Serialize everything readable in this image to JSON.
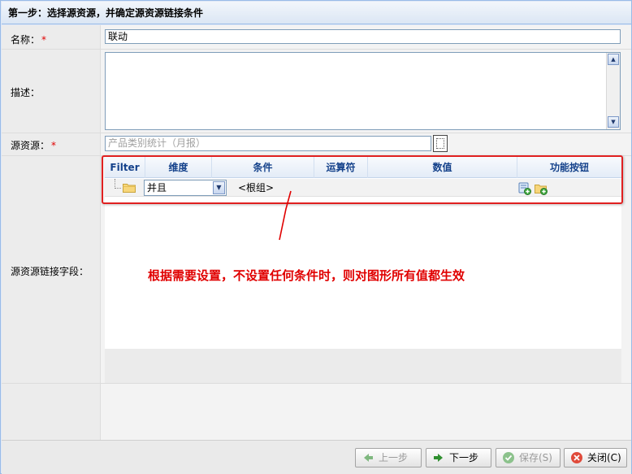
{
  "title": {
    "text": "第一步：选择源资源，并确定源资源链接条件"
  },
  "form": {
    "name_label": "名称：",
    "name_required": "*",
    "name_value": "联动",
    "desc_label": "描述：",
    "source_label": "源资源：",
    "source_required": "*",
    "source_placeholder": "产品类别统计（月报）",
    "link_label": "源资源链接字段："
  },
  "grid": {
    "columns": [
      "Filter",
      "维度",
      "条件",
      "运算符",
      "数值",
      "功能按钮"
    ],
    "row": {
      "logic_value": "并且",
      "condition": "<根组>"
    }
  },
  "annotation": {
    "text": "根据需要设置，不设置任何条件时，则对图形所有值都生效",
    "color": "#e00000"
  },
  "footer": {
    "prev_label": "上一步",
    "next_label": "下一步",
    "save_label": "保存(S)",
    "close_label": "关闭(C)"
  },
  "colors": {
    "header_text": "#15428b",
    "border": "#99bbe8",
    "required": "#e00000"
  }
}
